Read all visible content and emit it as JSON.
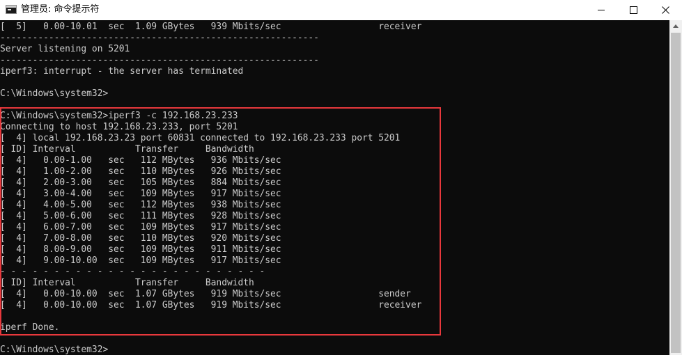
{
  "window": {
    "title": "管理员: 命令提示符",
    "icon": "console-icon"
  },
  "controls": {
    "minimize": "minimize-icon",
    "maximize": "maximize-icon",
    "close": "close-icon"
  },
  "console": {
    "lines": [
      "[  5]   0.00-10.01  sec  1.09 GBytes   939 Mbits/sec                  receiver",
      "-----------------------------------------------------------",
      "Server listening on 5201",
      "-----------------------------------------------------------",
      "iperf3: interrupt - the server has terminated",
      "",
      "C:\\Windows\\system32>",
      "",
      "C:\\Windows\\system32>iperf3 -c 192.168.23.233",
      "Connecting to host 192.168.23.233, port 5201",
      "[  4] local 192.168.23.23 port 60831 connected to 192.168.23.233 port 5201",
      "[ ID] Interval           Transfer     Bandwidth",
      "[  4]   0.00-1.00   sec   112 MBytes   936 Mbits/sec",
      "[  4]   1.00-2.00   sec   110 MBytes   926 Mbits/sec",
      "[  4]   2.00-3.00   sec   105 MBytes   884 Mbits/sec",
      "[  4]   3.00-4.00   sec   109 MBytes   917 Mbits/sec",
      "[  4]   4.00-5.00   sec   112 MBytes   938 Mbits/sec",
      "[  4]   5.00-6.00   sec   111 MBytes   928 Mbits/sec",
      "[  4]   6.00-7.00   sec   109 MBytes   917 Mbits/sec",
      "[  4]   7.00-8.00   sec   110 MBytes   920 Mbits/sec",
      "[  4]   8.00-9.00   sec   109 MBytes   911 Mbits/sec",
      "[  4]   9.00-10.00  sec   109 MBytes   917 Mbits/sec",
      "- - - - - - - - - - - - - - - - - - - - - - - - -",
      "[ ID] Interval           Transfer     Bandwidth",
      "[  4]   0.00-10.00  sec  1.07 GBytes   919 Mbits/sec                  sender",
      "[  4]   0.00-10.00  sec  1.07 GBytes   919 Mbits/sec                  receiver",
      "",
      "iperf Done.",
      "",
      "C:\\Windows\\system32>"
    ]
  },
  "colors": {
    "console_background": "#0c0c0c",
    "console_text": "#cccccc",
    "highlight_border": "#e8383c"
  }
}
